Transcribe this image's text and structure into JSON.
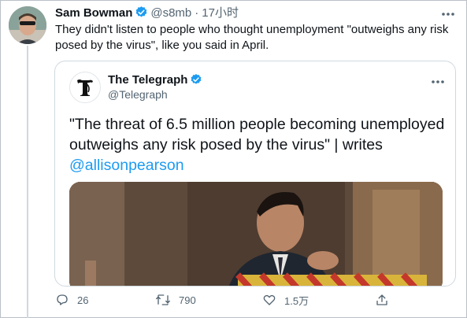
{
  "tweet": {
    "author_name": "Sam Bowman",
    "handle": "@s8mb",
    "separator": "·",
    "time": "17小时",
    "text": "They didn't listen to people who thought unemployment \"outweighs any risk posed by the virus\", like you said in April."
  },
  "quoted": {
    "author_name": "The Telegraph",
    "handle": "@Telegraph",
    "text": "\"The threat of 6.5 million people becoming unemployed outweighs any risk posed by the virus\" | writes ",
    "mention": "@allisonpearson"
  },
  "actions": {
    "reply_count": "26",
    "retweet_count": "790",
    "like_count": "1.5万"
  },
  "icons": {
    "verified": "verified-badge-icon",
    "more": "more-options-icon",
    "reply": "reply-icon",
    "retweet": "retweet-icon",
    "like": "like-icon",
    "share": "share-icon"
  },
  "colors": {
    "accent": "#1d9bf0",
    "muted": "#536471",
    "text": "#0f1419"
  }
}
